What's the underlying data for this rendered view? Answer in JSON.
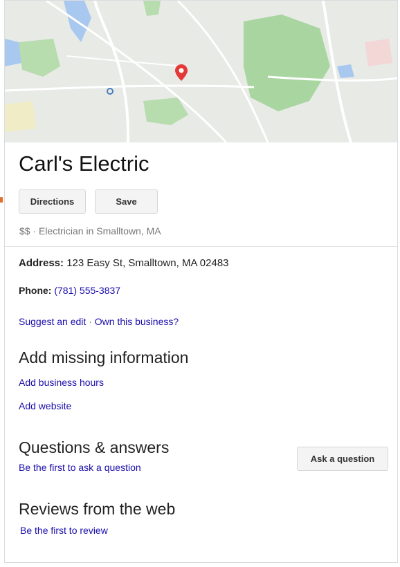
{
  "business": {
    "name": "Carl's Electric",
    "category": "$$ · Electrician in Smalltown, MA"
  },
  "actions": {
    "directions_label": "Directions",
    "save_label": "Save",
    "ask_label": "Ask a question"
  },
  "details": {
    "address_label": "Address:",
    "address_value": "123 Easy St, Smalltown, MA 02483",
    "phone_label": "Phone:",
    "phone_value": "(781) 555-3837"
  },
  "edit_links": {
    "suggest": "Suggest an edit",
    "separator": "·",
    "own": "Own this business?"
  },
  "missing_info": {
    "heading": "Add missing information",
    "hours": "Add business hours",
    "website": "Add website"
  },
  "qa": {
    "heading": "Questions & answers",
    "prompt": "Be the first to ask a question"
  },
  "reviews": {
    "heading": "Reviews from the web",
    "prompt": "Be the first to review"
  },
  "map": {
    "pin_icon": "map-pin-icon",
    "colors": {
      "land": "#e8eae6",
      "park": "#a8d5a0",
      "water": "#a8c8f0",
      "road": "#ffffff",
      "pin": "#e53935"
    }
  }
}
